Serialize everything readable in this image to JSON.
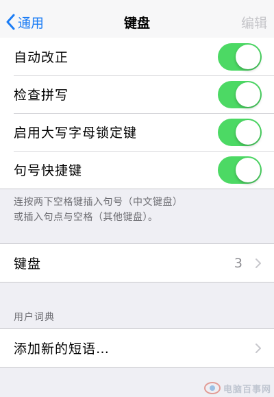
{
  "navbar": {
    "back_label": "通用",
    "title": "键盘",
    "edit_label": "编辑"
  },
  "toggles": [
    {
      "label": "自动改正",
      "on": true
    },
    {
      "label": "检查拼写",
      "on": true
    },
    {
      "label": "启用大写字母锁定键",
      "on": true
    },
    {
      "label": "句号快捷键",
      "on": true
    }
  ],
  "footnote": {
    "line1": "连按两下空格键插入句号（中文键盘）",
    "line2": "或插入句点与空格（其他键盘）。"
  },
  "keyboards": {
    "label": "键盘",
    "count": "3"
  },
  "user_dictionary": {
    "header": "用户词典",
    "add_phrase_label": "添加新的短语…"
  },
  "watermark": {
    "text": "电脑百事网"
  },
  "colors": {
    "accent": "#1a7cf5",
    "toggle_on": "#4cd964",
    "background": "#efeff4",
    "secondary_text": "#6d6d72",
    "disabled_text": "#c4c4c8"
  }
}
